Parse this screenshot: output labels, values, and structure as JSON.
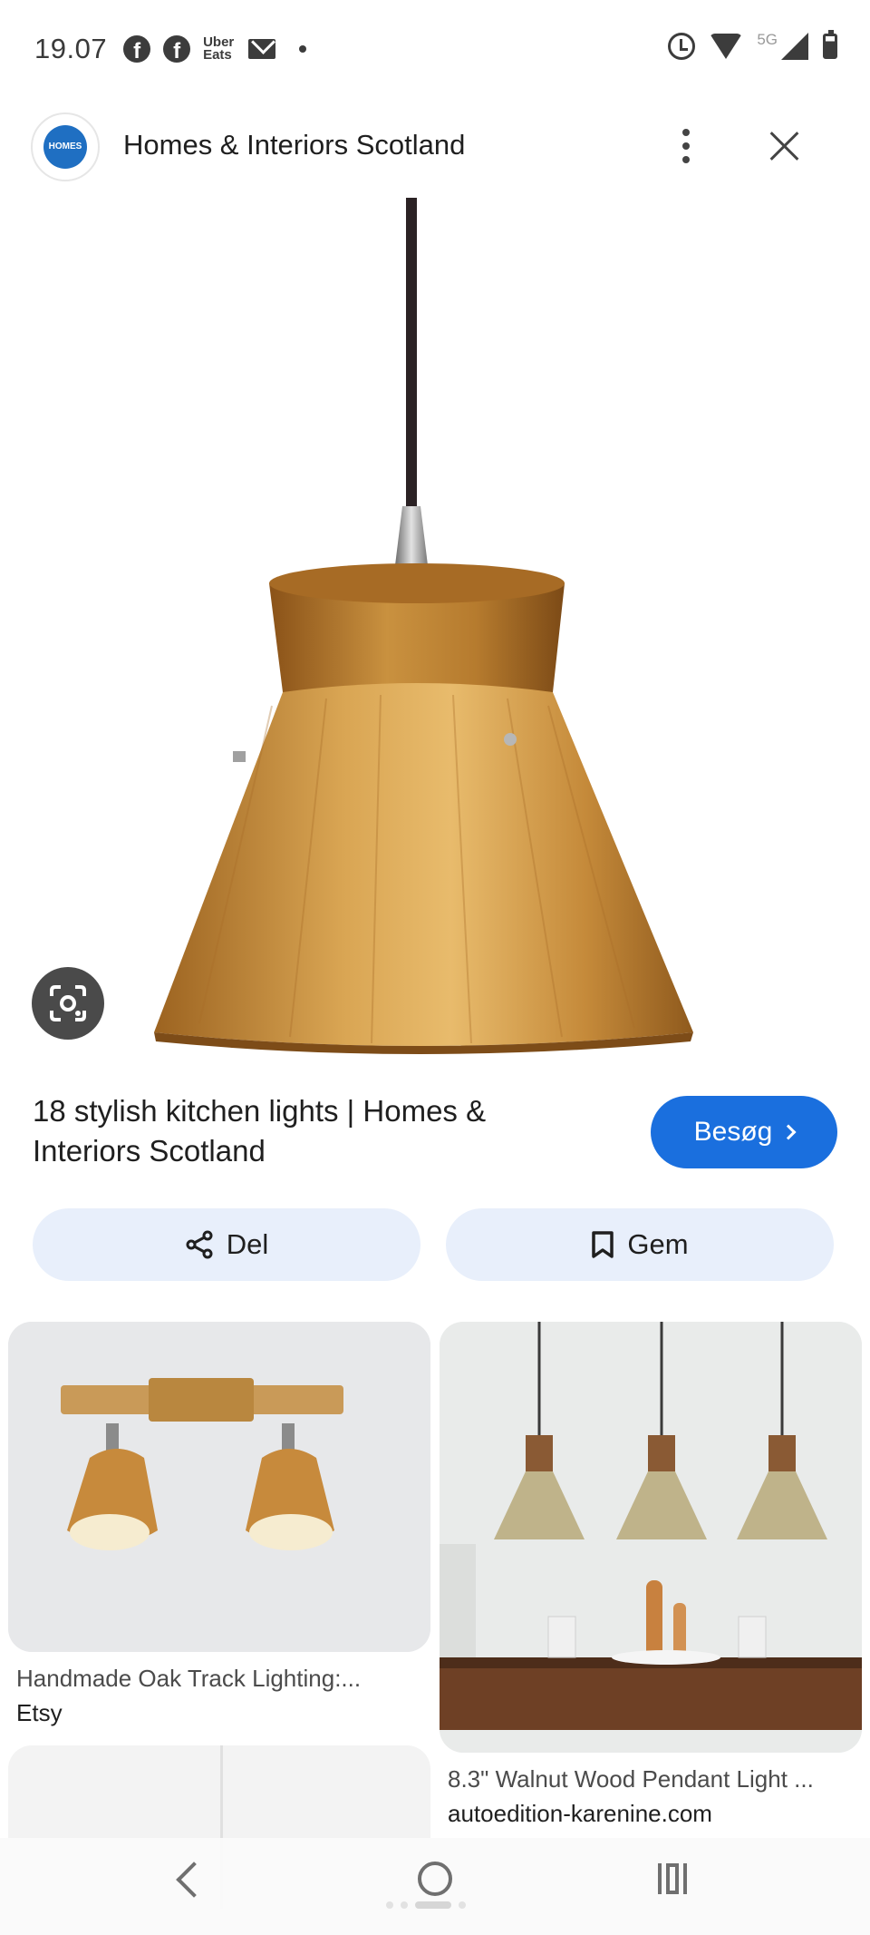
{
  "status_bar": {
    "time": "19.07",
    "uber_eats": "Uber\nEats",
    "uber_line1": "Uber",
    "uber_line2": "Eats",
    "network": "5G"
  },
  "header": {
    "site_name": "Homes & Interiors Scotland",
    "logo_text": "HOMES"
  },
  "result": {
    "title": "18 stylish kitchen lights | Homes & Interiors Scotland",
    "visit_label": "Besøg"
  },
  "actions": {
    "share_label": "Del",
    "save_label": "Gem"
  },
  "related": [
    {
      "title": "Handmade Oak Track Lighting:...",
      "source": "Etsy"
    },
    {
      "title": "8.3\" Walnut Wood Pendant Light ...",
      "source": "autoedition-karenine.com"
    }
  ],
  "colors": {
    "accent": "#1a6fde",
    "action_bg": "#e8effb",
    "wood": "#c48a3c"
  },
  "icons": [
    "facebook-icon",
    "uber-eats-icon",
    "mail-icon",
    "alarm-icon",
    "wifi-icon",
    "signal-icon",
    "battery-icon",
    "more-vert-icon",
    "close-icon",
    "lens-icon",
    "chevron-right-icon",
    "share-icon",
    "bookmark-icon",
    "back-icon",
    "home-icon",
    "recents-icon"
  ]
}
